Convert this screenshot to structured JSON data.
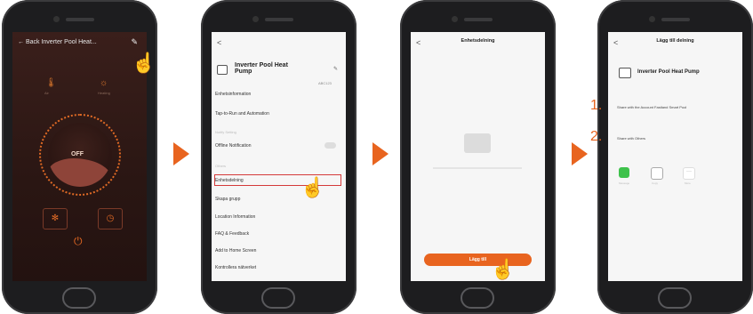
{
  "phone1": {
    "back_label": "← Back",
    "title": "Inverter Pool Heat...",
    "edit_icon": "pencil-icon",
    "mode_left": "🌡",
    "mode_left_label": "Air",
    "mode_right": "☼",
    "mode_right_label": "Heating",
    "status": "OFF",
    "fan_icon": "fan-icon",
    "timer_icon": "timer-icon",
    "power_icon": "power-icon"
  },
  "phone2": {
    "back": "<",
    "device_name": "Inverter Pool Heat\nPump",
    "device_id": "ABC123",
    "rows": {
      "info": "Enhetsinformation",
      "tap": "Tap-to-Run and Automation",
      "section_notify": "Notify Setting",
      "offline": "Offline Notification",
      "section_others": "Others",
      "share": "Enhetsdelning",
      "group": "Skapa grupp",
      "location": "Location Information",
      "faq": "FAQ & Feedback",
      "home": "Add to Home Screen",
      "network": "Kontrollera nätverket"
    }
  },
  "phone3": {
    "back": "<",
    "title": "Enhetsdelning",
    "cta": "Lägg till"
  },
  "phone4": {
    "back": "<",
    "title": "Lägg till delning",
    "device_name": "Inverter Pool Heat Pump",
    "step1_num": "1.",
    "step1_text": "Share with the Account Fastland Smart Pool",
    "step2_num": "2.",
    "step2_text": "Share with Others",
    "apps": [
      "Message",
      "Copy",
      "More"
    ]
  },
  "colors": {
    "accent": "#e8641f",
    "dark_bg": "#2a1613",
    "highlight": "#d43a3a"
  }
}
